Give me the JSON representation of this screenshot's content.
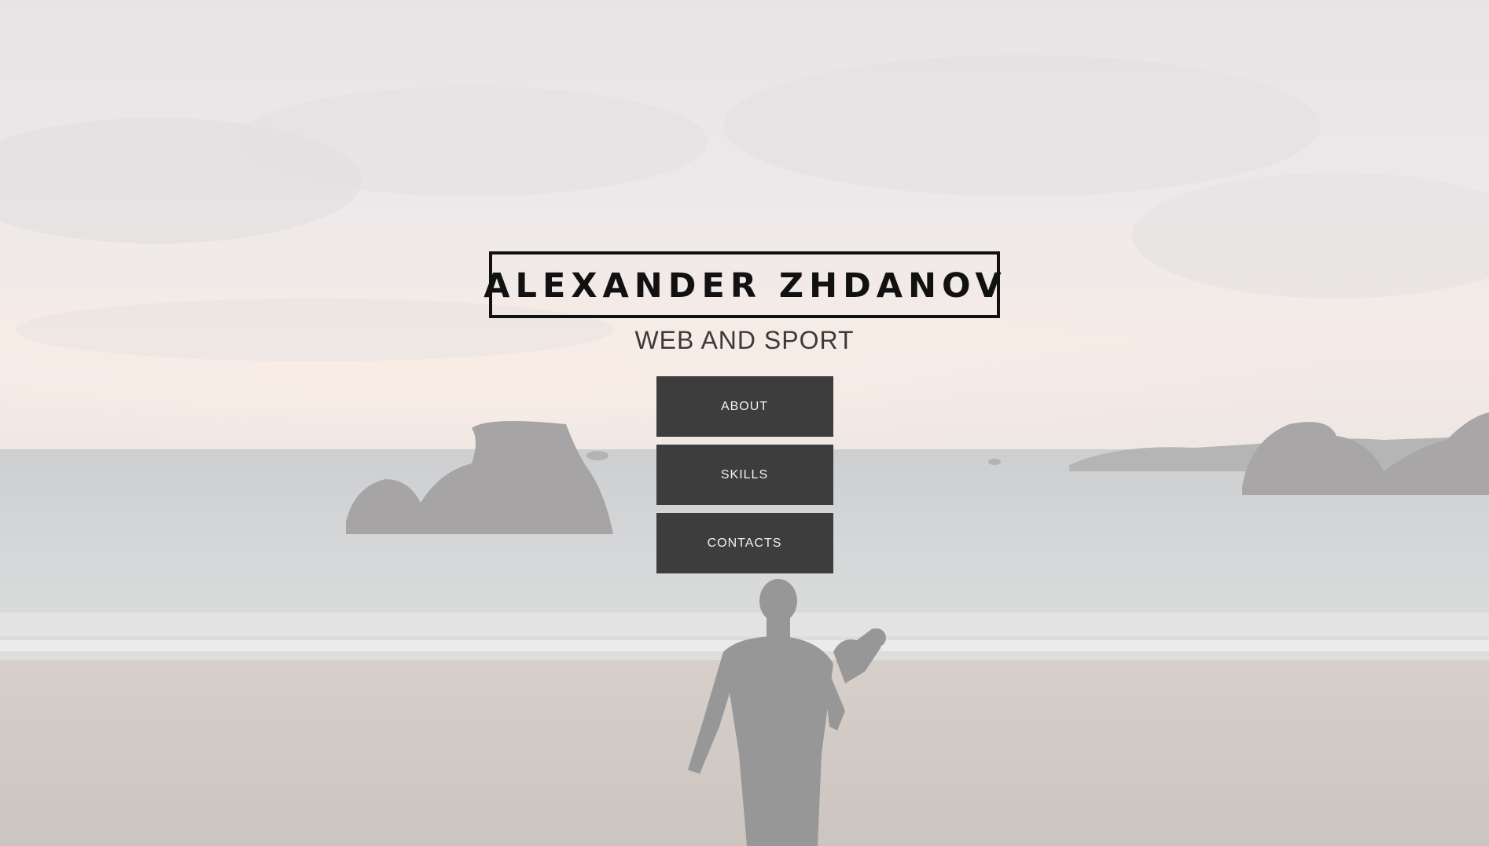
{
  "hero": {
    "title": "ALEXANDER ZHDANOV",
    "subtitle": "WEB AND SPORT"
  },
  "nav": {
    "items": [
      {
        "label": "ABOUT"
      },
      {
        "label": "SKILLS"
      },
      {
        "label": "CONTACTS"
      }
    ]
  },
  "colors": {
    "button_bg": "#3d3d3d",
    "button_text": "#f2f2f2",
    "title_text": "#111111",
    "subtitle_text": "#3a3a3a"
  }
}
